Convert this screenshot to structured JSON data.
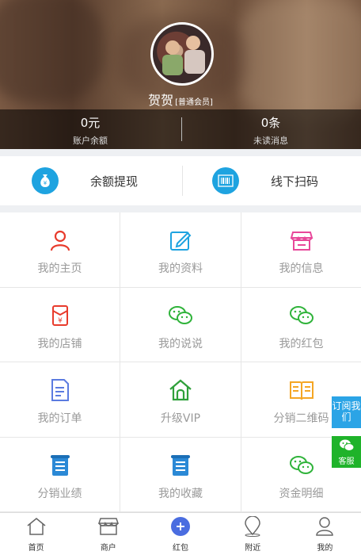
{
  "profile": {
    "name": "贺贺",
    "level": "[普通会员]",
    "balance_value": "0元",
    "balance_label": "账户余额",
    "messages_value": "0条",
    "messages_label": "未读消息"
  },
  "actions": [
    {
      "label": "余额提现",
      "icon": "money-bag-icon"
    },
    {
      "label": "线下扫码",
      "icon": "barcode-icon"
    }
  ],
  "grid": [
    {
      "label": "我的主页",
      "icon": "user-icon",
      "color": "#e83b2c"
    },
    {
      "label": "我的资料",
      "icon": "edit-icon",
      "color": "#1ea3e0"
    },
    {
      "label": "我的信息",
      "icon": "store-icon",
      "color": "#e8489a"
    },
    {
      "label": "我的店铺",
      "icon": "red-envelope-icon",
      "color": "#e83b2c"
    },
    {
      "label": "我的说说",
      "icon": "wechat-icon",
      "color": "#2fb33a"
    },
    {
      "label": "我的红包",
      "icon": "wechat-icon",
      "color": "#2fb33a"
    },
    {
      "label": "我的订单",
      "icon": "document-icon",
      "color": "#5b7be0"
    },
    {
      "label": "升级VIP",
      "icon": "home-icon",
      "color": "#2fa03a"
    },
    {
      "label": "分销二维码",
      "icon": "book-icon",
      "color": "#f5a623"
    },
    {
      "label": "分销业绩",
      "icon": "list-icon",
      "color": "#2b89d6"
    },
    {
      "label": "我的收藏",
      "icon": "list-icon",
      "color": "#2b89d6"
    },
    {
      "label": "资金明细",
      "icon": "wechat-icon",
      "color": "#2fb33a"
    }
  ],
  "float": {
    "subscribe": "订阅我们",
    "service": "客服"
  },
  "tabs": [
    {
      "label": "首页",
      "icon": "home-outline-icon"
    },
    {
      "label": "商户",
      "icon": "shop-icon"
    },
    {
      "label": "红包",
      "icon": "plus-circle-icon"
    },
    {
      "label": "附近",
      "icon": "location-icon"
    },
    {
      "label": "我的",
      "icon": "person-icon"
    }
  ]
}
